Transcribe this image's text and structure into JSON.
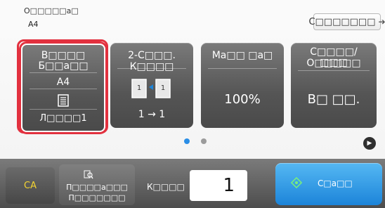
{
  "header": {
    "original_label": "O□□□□□a□",
    "original_size": "A4",
    "others_button": "C□□□□□□□"
  },
  "tiles": [
    {
      "id": "original",
      "title_line1": "B□□□□",
      "title_line2": "Б□□a□□",
      "size": "A4",
      "footer": "Л□□□□1"
    },
    {
      "id": "duplex",
      "title": "2-C□□□. К□□□□",
      "mapping": "1 → 1"
    },
    {
      "id": "zoom",
      "title": "Ма□□ □а□",
      "value": "100%"
    },
    {
      "id": "output",
      "title_line1": "С□□□□/О□□□□□",
      "title_line2": "□□□",
      "value": "В□ □□."
    }
  ],
  "pagination": {
    "current_page": 1,
    "total_pages": 2
  },
  "bottom": {
    "ca_label": "CA",
    "preview_line1": "П□□□□а□□□",
    "preview_line2": "П□□□□□□□",
    "copies_label": "К□□□□",
    "copies_value": "1",
    "start_label": "С□а□□"
  },
  "colors": {
    "selection": "#e2313f",
    "active_dot": "#2a8ee6",
    "ca_text": "#f4d432",
    "start_button": "#1c84d9"
  }
}
